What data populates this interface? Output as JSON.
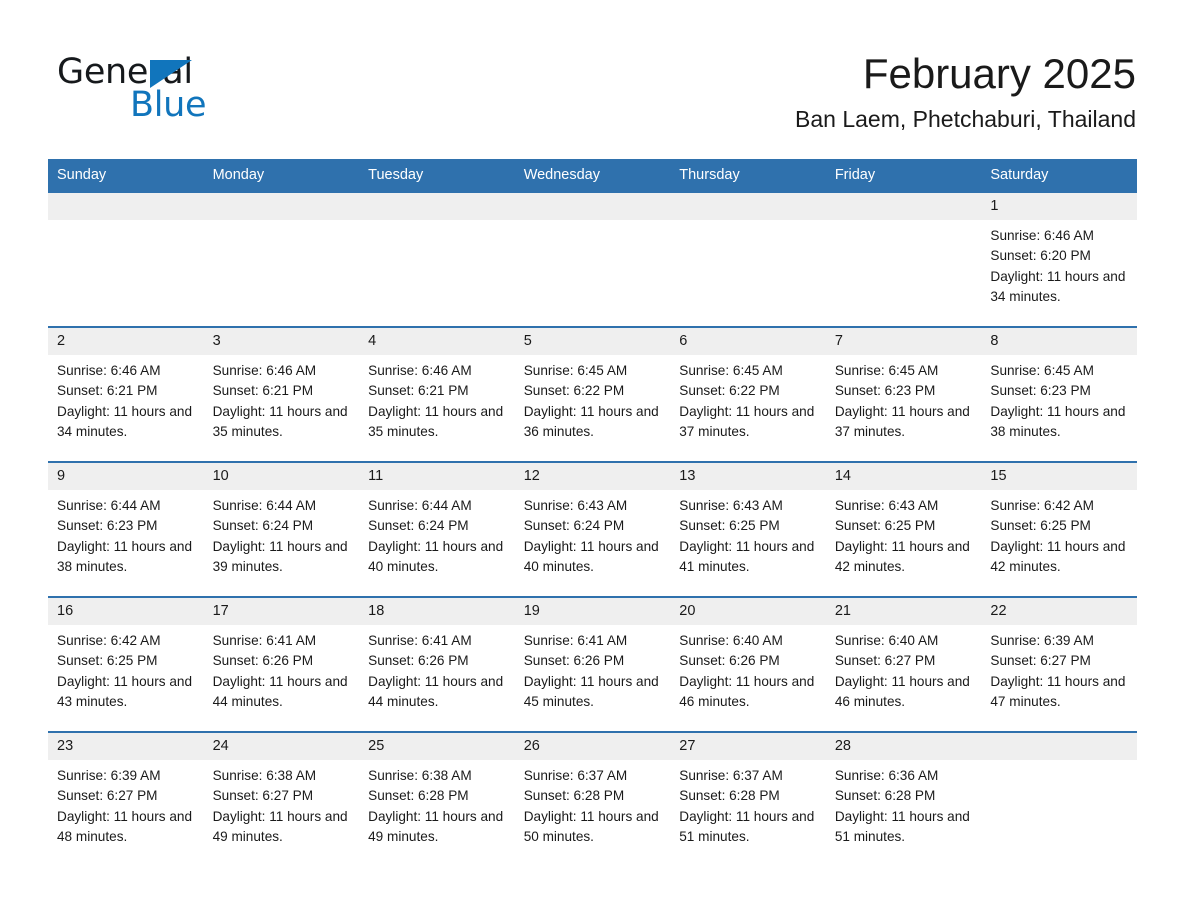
{
  "brand": {
    "name_part1": "General",
    "name_part2": "Blue",
    "triangle_icon": "triangle-icon",
    "color_blue": "#1175bc",
    "color_dark": "#16191c"
  },
  "header": {
    "title": "February 2025",
    "subtitle": "Ban Laem, Phetchaburi, Thailand"
  },
  "theme": {
    "header_bg": "#2f71ad",
    "header_text": "#ffffff",
    "daynum_bg": "#efefef",
    "row_border": "#2f71ad",
    "body_bg": "#ffffff"
  },
  "weekdays": [
    "Sunday",
    "Monday",
    "Tuesday",
    "Wednesday",
    "Thursday",
    "Friday",
    "Saturday"
  ],
  "labels": {
    "sunrise_prefix": "Sunrise:",
    "sunset_prefix": "Sunset:",
    "daylight_prefix": "Daylight:"
  },
  "weeks": [
    [
      {
        "day": "",
        "sunrise": "",
        "sunset": "",
        "daylight": "",
        "empty": true
      },
      {
        "day": "",
        "sunrise": "",
        "sunset": "",
        "daylight": "",
        "empty": true
      },
      {
        "day": "",
        "sunrise": "",
        "sunset": "",
        "daylight": "",
        "empty": true
      },
      {
        "day": "",
        "sunrise": "",
        "sunset": "",
        "daylight": "",
        "empty": true
      },
      {
        "day": "",
        "sunrise": "",
        "sunset": "",
        "daylight": "",
        "empty": true
      },
      {
        "day": "",
        "sunrise": "",
        "sunset": "",
        "daylight": "",
        "empty": true
      },
      {
        "day": "1",
        "sunrise": "Sunrise: 6:46 AM",
        "sunset": "Sunset: 6:20 PM",
        "daylight": "Daylight: 11 hours and 34 minutes.",
        "empty": false
      }
    ],
    [
      {
        "day": "2",
        "sunrise": "Sunrise: 6:46 AM",
        "sunset": "Sunset: 6:21 PM",
        "daylight": "Daylight: 11 hours and 34 minutes.",
        "empty": false
      },
      {
        "day": "3",
        "sunrise": "Sunrise: 6:46 AM",
        "sunset": "Sunset: 6:21 PM",
        "daylight": "Daylight: 11 hours and 35 minutes.",
        "empty": false
      },
      {
        "day": "4",
        "sunrise": "Sunrise: 6:46 AM",
        "sunset": "Sunset: 6:21 PM",
        "daylight": "Daylight: 11 hours and 35 minutes.",
        "empty": false
      },
      {
        "day": "5",
        "sunrise": "Sunrise: 6:45 AM",
        "sunset": "Sunset: 6:22 PM",
        "daylight": "Daylight: 11 hours and 36 minutes.",
        "empty": false
      },
      {
        "day": "6",
        "sunrise": "Sunrise: 6:45 AM",
        "sunset": "Sunset: 6:22 PM",
        "daylight": "Daylight: 11 hours and 37 minutes.",
        "empty": false
      },
      {
        "day": "7",
        "sunrise": "Sunrise: 6:45 AM",
        "sunset": "Sunset: 6:23 PM",
        "daylight": "Daylight: 11 hours and 37 minutes.",
        "empty": false
      },
      {
        "day": "8",
        "sunrise": "Sunrise: 6:45 AM",
        "sunset": "Sunset: 6:23 PM",
        "daylight": "Daylight: 11 hours and 38 minutes.",
        "empty": false
      }
    ],
    [
      {
        "day": "9",
        "sunrise": "Sunrise: 6:44 AM",
        "sunset": "Sunset: 6:23 PM",
        "daylight": "Daylight: 11 hours and 38 minutes.",
        "empty": false
      },
      {
        "day": "10",
        "sunrise": "Sunrise: 6:44 AM",
        "sunset": "Sunset: 6:24 PM",
        "daylight": "Daylight: 11 hours and 39 minutes.",
        "empty": false
      },
      {
        "day": "11",
        "sunrise": "Sunrise: 6:44 AM",
        "sunset": "Sunset: 6:24 PM",
        "daylight": "Daylight: 11 hours and 40 minutes.",
        "empty": false
      },
      {
        "day": "12",
        "sunrise": "Sunrise: 6:43 AM",
        "sunset": "Sunset: 6:24 PM",
        "daylight": "Daylight: 11 hours and 40 minutes.",
        "empty": false
      },
      {
        "day": "13",
        "sunrise": "Sunrise: 6:43 AM",
        "sunset": "Sunset: 6:25 PM",
        "daylight": "Daylight: 11 hours and 41 minutes.",
        "empty": false
      },
      {
        "day": "14",
        "sunrise": "Sunrise: 6:43 AM",
        "sunset": "Sunset: 6:25 PM",
        "daylight": "Daylight: 11 hours and 42 minutes.",
        "empty": false
      },
      {
        "day": "15",
        "sunrise": "Sunrise: 6:42 AM",
        "sunset": "Sunset: 6:25 PM",
        "daylight": "Daylight: 11 hours and 42 minutes.",
        "empty": false
      }
    ],
    [
      {
        "day": "16",
        "sunrise": "Sunrise: 6:42 AM",
        "sunset": "Sunset: 6:25 PM",
        "daylight": "Daylight: 11 hours and 43 minutes.",
        "empty": false
      },
      {
        "day": "17",
        "sunrise": "Sunrise: 6:41 AM",
        "sunset": "Sunset: 6:26 PM",
        "daylight": "Daylight: 11 hours and 44 minutes.",
        "empty": false
      },
      {
        "day": "18",
        "sunrise": "Sunrise: 6:41 AM",
        "sunset": "Sunset: 6:26 PM",
        "daylight": "Daylight: 11 hours and 44 minutes.",
        "empty": false
      },
      {
        "day": "19",
        "sunrise": "Sunrise: 6:41 AM",
        "sunset": "Sunset: 6:26 PM",
        "daylight": "Daylight: 11 hours and 45 minutes.",
        "empty": false
      },
      {
        "day": "20",
        "sunrise": "Sunrise: 6:40 AM",
        "sunset": "Sunset: 6:26 PM",
        "daylight": "Daylight: 11 hours and 46 minutes.",
        "empty": false
      },
      {
        "day": "21",
        "sunrise": "Sunrise: 6:40 AM",
        "sunset": "Sunset: 6:27 PM",
        "daylight": "Daylight: 11 hours and 46 minutes.",
        "empty": false
      },
      {
        "day": "22",
        "sunrise": "Sunrise: 6:39 AM",
        "sunset": "Sunset: 6:27 PM",
        "daylight": "Daylight: 11 hours and 47 minutes.",
        "empty": false
      }
    ],
    [
      {
        "day": "23",
        "sunrise": "Sunrise: 6:39 AM",
        "sunset": "Sunset: 6:27 PM",
        "daylight": "Daylight: 11 hours and 48 minutes.",
        "empty": false
      },
      {
        "day": "24",
        "sunrise": "Sunrise: 6:38 AM",
        "sunset": "Sunset: 6:27 PM",
        "daylight": "Daylight: 11 hours and 49 minutes.",
        "empty": false
      },
      {
        "day": "25",
        "sunrise": "Sunrise: 6:38 AM",
        "sunset": "Sunset: 6:28 PM",
        "daylight": "Daylight: 11 hours and 49 minutes.",
        "empty": false
      },
      {
        "day": "26",
        "sunrise": "Sunrise: 6:37 AM",
        "sunset": "Sunset: 6:28 PM",
        "daylight": "Daylight: 11 hours and 50 minutes.",
        "empty": false
      },
      {
        "day": "27",
        "sunrise": "Sunrise: 6:37 AM",
        "sunset": "Sunset: 6:28 PM",
        "daylight": "Daylight: 11 hours and 51 minutes.",
        "empty": false
      },
      {
        "day": "28",
        "sunrise": "Sunrise: 6:36 AM",
        "sunset": "Sunset: 6:28 PM",
        "daylight": "Daylight: 11 hours and 51 minutes.",
        "empty": false
      },
      {
        "day": "",
        "sunrise": "",
        "sunset": "",
        "daylight": "",
        "empty": true
      }
    ]
  ]
}
